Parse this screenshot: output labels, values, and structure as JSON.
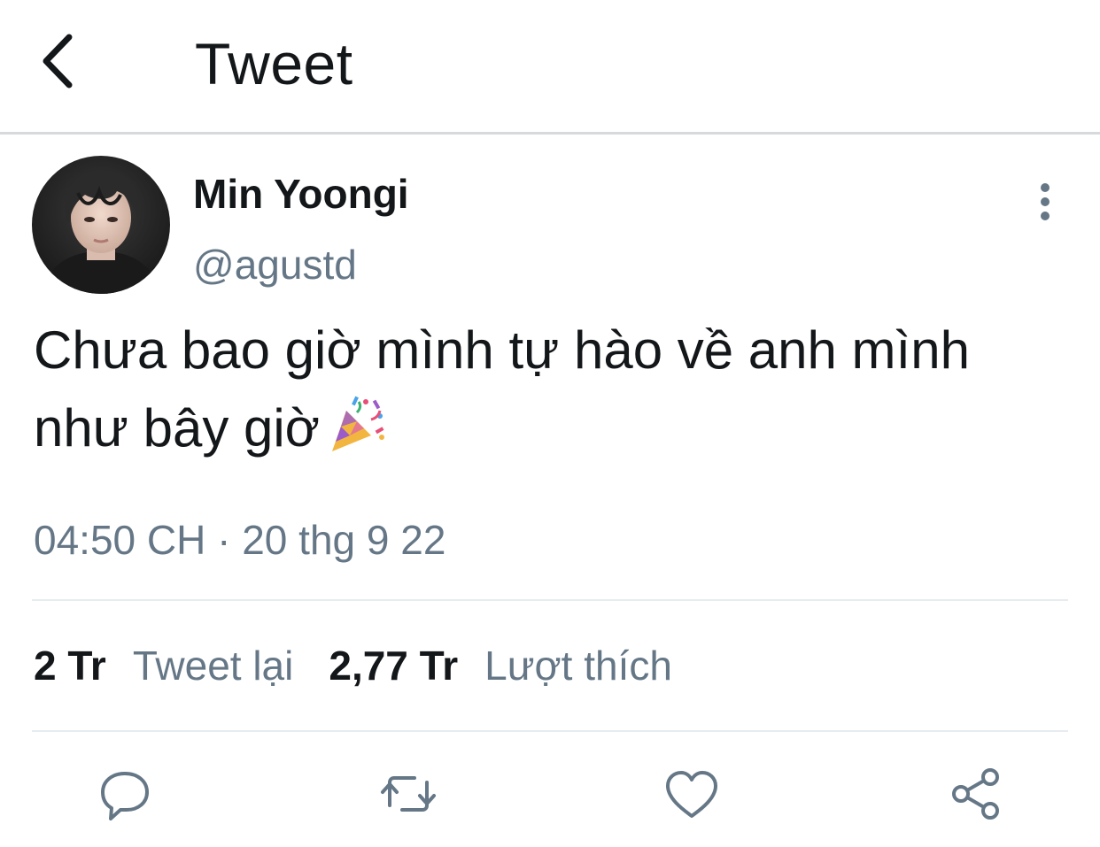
{
  "header": {
    "title": "Tweet"
  },
  "author": {
    "display_name": "Min Yoongi",
    "handle": "@agustd"
  },
  "tweet": {
    "text": "Chưa bao giờ mình tự hào về anh mình như bây giờ",
    "emoji": "party-popper-icon",
    "timestamp": "04:50 CH · 20 thg 9 22"
  },
  "stats": {
    "retweet_count": "2 Tr",
    "retweet_label": "Tweet lại",
    "like_count": "2,77 Tr",
    "like_label": "Lượt thích"
  },
  "colors": {
    "text_primary": "#14171a",
    "text_secondary": "#657786",
    "icon": "#657786",
    "divider": "#e6ecf0"
  }
}
